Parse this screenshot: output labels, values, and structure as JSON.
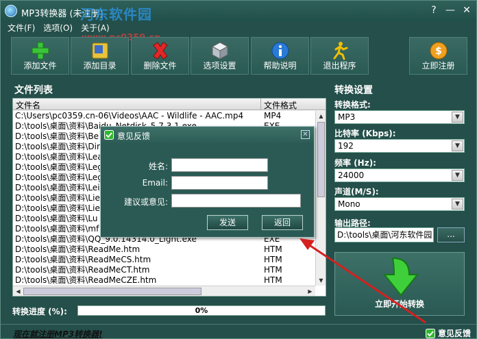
{
  "window": {
    "title": "MP3转换器 (未注册)",
    "controls": [
      "?",
      "—",
      "✕"
    ]
  },
  "watermark": {
    "logo": "河东软件园",
    "url": "www.pc0359.cn"
  },
  "menu": [
    "文件(F)",
    "选项(O)",
    "关于(A)"
  ],
  "toolbar": [
    {
      "label": "添加文件",
      "icon": "plus-icon"
    },
    {
      "label": "添加目录",
      "icon": "folder-icon"
    },
    {
      "label": "删除文件",
      "icon": "delete-x-icon"
    },
    {
      "label": "选项设置",
      "icon": "cube-icon"
    },
    {
      "label": "帮助说明",
      "icon": "info-icon"
    },
    {
      "label": "退出程序",
      "icon": "running-man-icon"
    },
    {
      "label": "立即注册",
      "icon": "coin-icon"
    }
  ],
  "file_list": {
    "title": "文件列表",
    "columns": [
      "文件名",
      "文件格式"
    ],
    "rows": [
      {
        "name": "C:\\Users\\pc0359.cn-06\\Videos\\AAC - Wildlife - AAC.mp4",
        "format": "MP4"
      },
      {
        "name": "D:\\tools\\桌面\\资料\\Baidu_Netdisk_5.7.3.1.exe",
        "format": "EXE"
      },
      {
        "name": "D:\\tools\\桌面\\资料\\Be",
        "format": ""
      },
      {
        "name": "D:\\tools\\桌面\\资料\\Dir",
        "format": ""
      },
      {
        "name": "D:\\tools\\桌面\\资料\\Lea",
        "format": ""
      },
      {
        "name": "D:\\tools\\桌面\\资料\\Leg",
        "format": ""
      },
      {
        "name": "D:\\tools\\桌面\\资料\\Leg",
        "format": ""
      },
      {
        "name": "D:\\tools\\桌面\\资料\\Lei",
        "format": ""
      },
      {
        "name": "D:\\tools\\桌面\\资料\\Lie",
        "format": ""
      },
      {
        "name": "D:\\tools\\桌面\\资料\\Lie",
        "format": ""
      },
      {
        "name": "D:\\tools\\桌面\\资料\\Lu",
        "format": ""
      },
      {
        "name": "D:\\tools\\桌面\\资料\\mf",
        "format": ""
      },
      {
        "name": "D:\\tools\\桌面\\资料\\QQ_9.0.14314.0_Light.exe",
        "format": "EXE"
      },
      {
        "name": "D:\\tools\\桌面\\资料\\ReadMe.htm",
        "format": "HTM"
      },
      {
        "name": "D:\\tools\\桌面\\资料\\ReadMeCS.htm",
        "format": "HTM"
      },
      {
        "name": "D:\\tools\\桌面\\资料\\ReadMeCT.htm",
        "format": "HTM"
      },
      {
        "name": "D:\\tools\\桌面\\资料\\ReadMeCZE.htm",
        "format": "HTM"
      }
    ]
  },
  "settings": {
    "title": "转换设置",
    "format_label": "转换格式:",
    "format_value": "MP3",
    "bitrate_label": "比特率 (Kbps):",
    "bitrate_value": "192",
    "frequency_label": "频率 (Hz):",
    "frequency_value": "24000",
    "channel_label": "声道(M/S):",
    "channel_value": "Mono",
    "output_label": "输出路径:",
    "output_value": "D:\\tools\\桌面\\河东软件园",
    "browse_label": "...",
    "start_label": "立即开始转换"
  },
  "progress": {
    "label": "转换进度 (%):",
    "value": 0,
    "text": "0%"
  },
  "status": {
    "register_link": "现在就注册MP3转换器!",
    "feedback_link": "意见反馈"
  },
  "dialog": {
    "title": "意见反馈",
    "name_label": "姓名:",
    "name_value": "",
    "email_label": "Email:",
    "email_value": "",
    "suggestion_label": "建议或意见:",
    "suggestion_value": "",
    "send_label": "发送",
    "back_label": "返回",
    "close": "✕"
  },
  "colors": {
    "accent_green": "#37c53c",
    "arrow_red": "#d42020",
    "bg": "#244f4a"
  }
}
